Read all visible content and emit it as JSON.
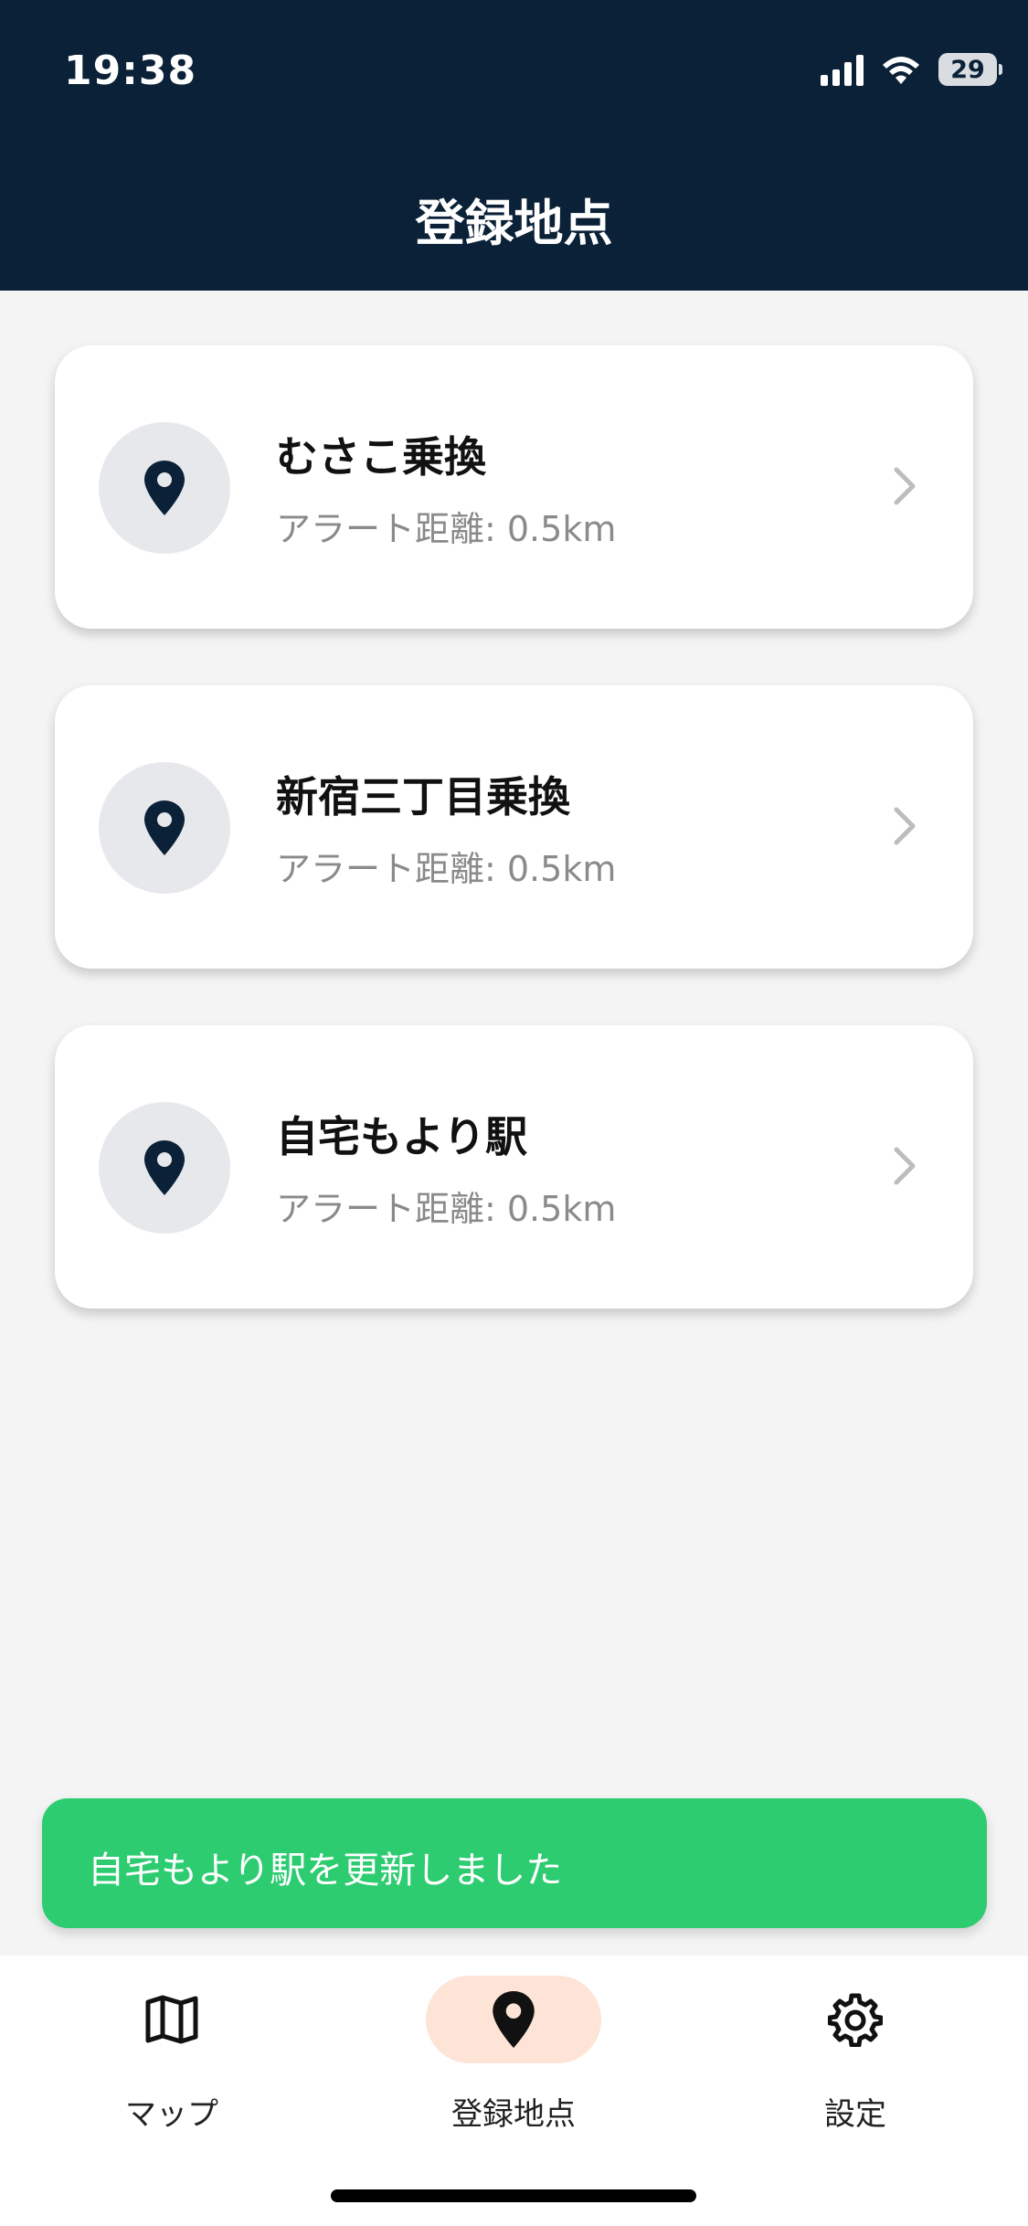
{
  "status_bar": {
    "time": "19:38",
    "battery": "29"
  },
  "header": {
    "title": "登録地点"
  },
  "locations": [
    {
      "name": "むさこ乗換",
      "subtitle": "アラート距離: 0.5km"
    },
    {
      "name": "新宿三丁目乗換",
      "subtitle": "アラート距離: 0.5km"
    },
    {
      "name": "自宅もより駅",
      "subtitle": "アラート距離: 0.5km"
    }
  ],
  "toast": {
    "message": "自宅もより駅を更新しました"
  },
  "tabbar": {
    "items": [
      {
        "label": "マップ",
        "icon": "map-icon"
      },
      {
        "label": "登録地点",
        "icon": "location-pin-icon",
        "active": true
      },
      {
        "label": "設定",
        "icon": "gear-icon"
      }
    ]
  },
  "colors": {
    "header_bg": "#0b2138",
    "toast_bg": "#2ecc71",
    "active_tab_bg": "#fde4d6",
    "pin": "#0b2138"
  }
}
